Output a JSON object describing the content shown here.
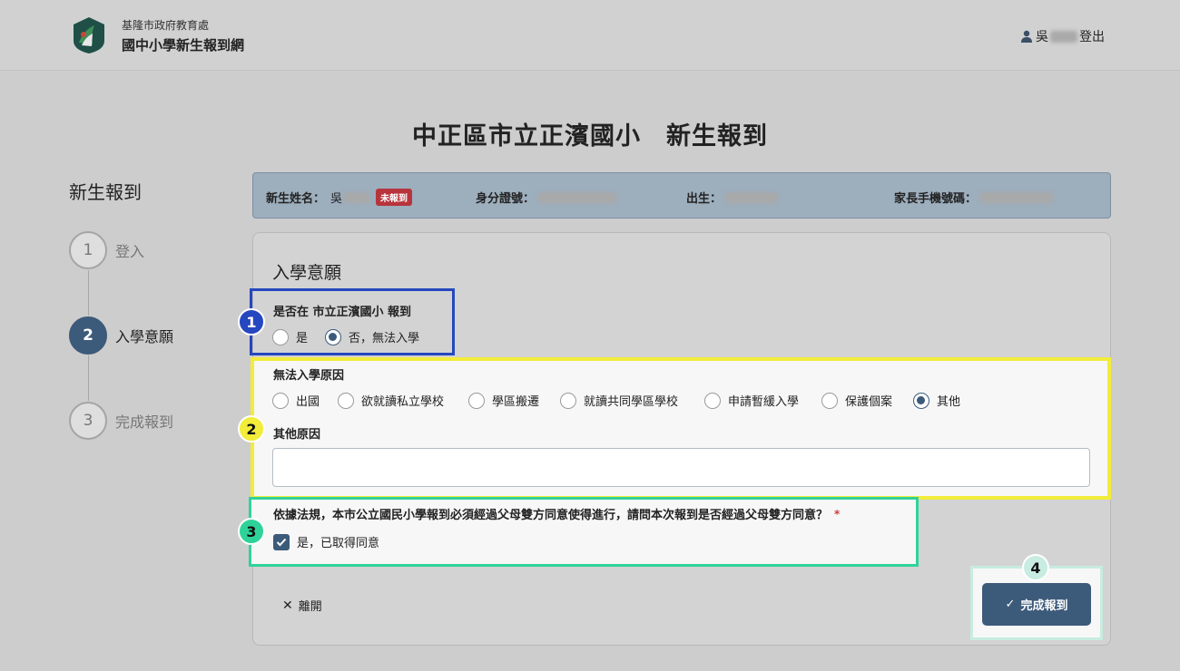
{
  "header": {
    "org_name": "基隆市政府教育處",
    "site_name": "國中小學新生報到網",
    "user_surname": "吳",
    "logout_label": "登出"
  },
  "page_title": "中正區市立正濱國小　新生報到",
  "sidebar": {
    "title": "新生報到",
    "steps": [
      {
        "num": "1",
        "label": "登入",
        "state": "done"
      },
      {
        "num": "2",
        "label": "入學意願",
        "state": "active"
      },
      {
        "num": "3",
        "label": "完成報到",
        "state": "pending"
      }
    ]
  },
  "student_info": {
    "name_label": "新生姓名：",
    "name_surname": "吳",
    "status_tag": "未報到",
    "id_label": "身分證號：",
    "birth_label": "出生：",
    "phone_label": "家長手機號碼："
  },
  "form": {
    "section_title": "入學意願",
    "q1": {
      "label": "是否在 市立正濱國小 報到",
      "options": [
        "是",
        "否，無法入學"
      ],
      "selected": "否，無法入學"
    },
    "q2": {
      "label": "無法入學原因",
      "options": [
        "出國",
        "欲就讀私立學校",
        "學區搬遷",
        "就讀共同學區學校",
        "申請暫緩入學",
        "保護個案",
        "其他"
      ],
      "selected": "其他",
      "other_label": "其他原因",
      "other_value": ""
    },
    "q3": {
      "label": "依據法規，本市公立國民小學報到必須經過父母雙方同意使得進行，請問本次報到是否經過父母雙方同意？",
      "required_mark": "*",
      "checkbox_label": "是，已取得同意",
      "checked": true
    },
    "leave_label": "離開",
    "finish_label": "完成報到"
  },
  "annotations": [
    "1",
    "2",
    "3",
    "4"
  ],
  "colors": {
    "primary": "#3c5a7a",
    "annotation_1": "#2547bf",
    "annotation_2": "#f2ec3a",
    "annotation_3": "#2fd39a",
    "annotation_4": "#c8ece1",
    "status_tag": "#b8343c"
  }
}
